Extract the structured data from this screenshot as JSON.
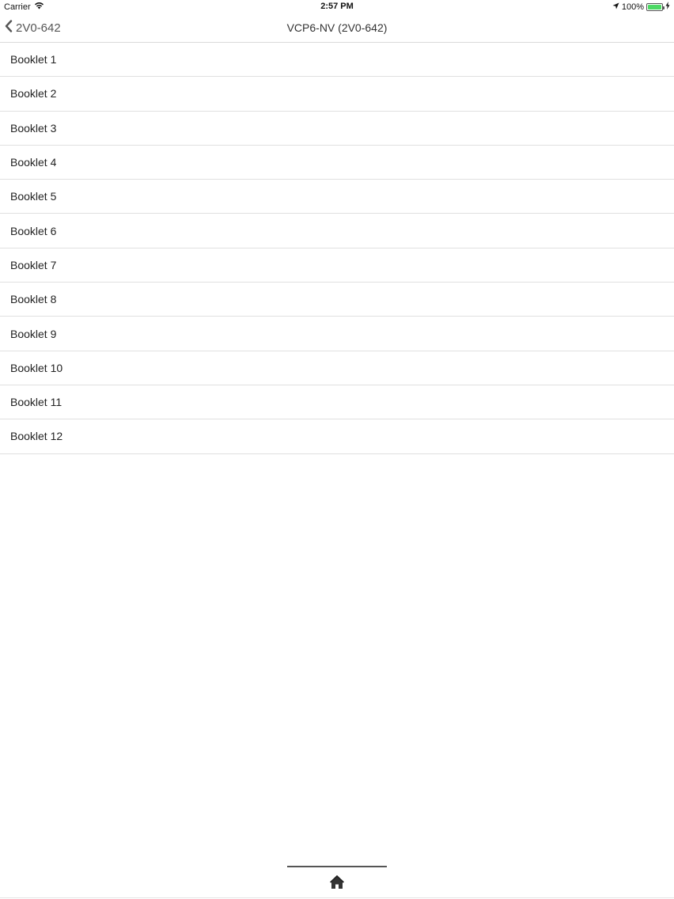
{
  "status_bar": {
    "carrier": "Carrier",
    "time": "2:57 PM",
    "battery_percent": "100%",
    "battery_level": 1.0,
    "battery_color": "#4cd964"
  },
  "nav": {
    "back_label": "2V0-642",
    "title": "VCP6-NV (2V0-642)"
  },
  "list": {
    "items": [
      {
        "label": "Booklet 1"
      },
      {
        "label": "Booklet 2"
      },
      {
        "label": "Booklet 3"
      },
      {
        "label": "Booklet 4"
      },
      {
        "label": "Booklet 5"
      },
      {
        "label": "Booklet 6"
      },
      {
        "label": "Booklet 7"
      },
      {
        "label": "Booklet 8"
      },
      {
        "label": "Booklet 9"
      },
      {
        "label": "Booklet 10"
      },
      {
        "label": "Booklet 11"
      },
      {
        "label": "Booklet 12"
      }
    ]
  },
  "toolbar": {
    "home_icon": "home-icon"
  }
}
